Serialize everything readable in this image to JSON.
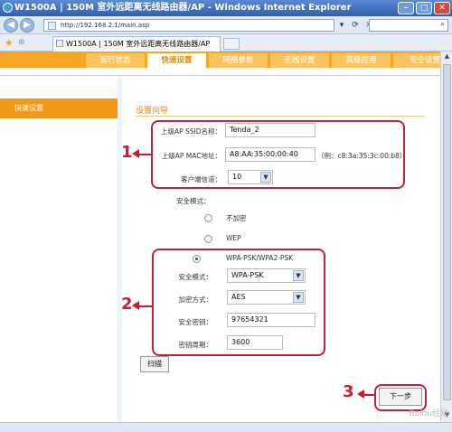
{
  "window": {
    "title": "W1500A | 150M 室外远距离无线路由器/AP - Windows Internet Explorer",
    "url": "http://192.168.2.1/main.asp",
    "tab_title": "W1500A | 150M 室外远距离无线路由器/AP"
  },
  "nav": {
    "tabs": [
      "运行状态",
      "快速设置",
      "网络参数",
      "无线设置",
      "高级应用",
      "安全设置"
    ],
    "active": "快速设置"
  },
  "sidebar": {
    "items": [
      {
        "label": "快速设置"
      }
    ]
  },
  "main": {
    "section_title": "设置向导",
    "ap_ssid": {
      "label": "上级AP SSID名称：",
      "value": "Tenda_2"
    },
    "ap_mac": {
      "label": "上级AP MAC地址：",
      "value": "A8:AA:35:00:00:40",
      "hint": "（例：c8:3a:35:3c:00:b8）"
    },
    "client_channel": {
      "label": "客户端信道：",
      "value": "10"
    },
    "security_mode_label": "安全模式：",
    "radios": [
      {
        "label": "不加密",
        "checked": false
      },
      {
        "label": "WEP",
        "checked": false
      },
      {
        "label": "WPA-PSK/WPA2-PSK",
        "checked": true
      }
    ],
    "wpa": {
      "mode": {
        "label": "安全模式：",
        "value": "WPA-PSK"
      },
      "cipher": {
        "label": "加密方式：",
        "value": "AES"
      },
      "key": {
        "label": "安全密钥：",
        "value": "97654321"
      },
      "period": {
        "label": "密钥周期：",
        "value": "3600"
      }
    },
    "scan_button": "扫描",
    "next_button": "下一步"
  },
  "annotations": {
    "n1": "1",
    "n2": "2",
    "n3": "3"
  },
  "watermark": "Baidu经验",
  "colors": {
    "accent": "#f5a623",
    "annotation": "#d2182f"
  }
}
